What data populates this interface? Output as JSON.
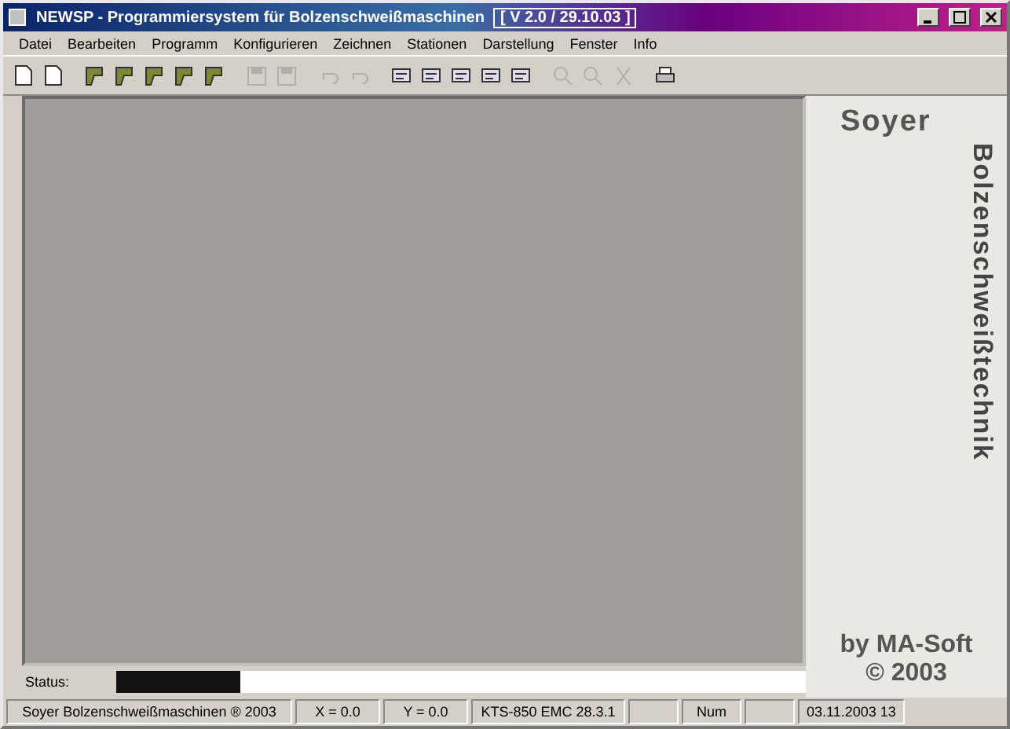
{
  "window": {
    "title": "NEWSP - Programmiersystem für Bolzenschweißmaschinen",
    "version": "[ V 2.0 / 29.10.03 ]"
  },
  "menu": [
    "Datei",
    "Bearbeiten",
    "Programm",
    "Konfigurieren",
    "Zeichnen",
    "Stationen",
    "Darstellung",
    "Fenster",
    "Info"
  ],
  "toolbar": [
    {
      "kind": "doc",
      "disabled": false
    },
    {
      "kind": "doc",
      "disabled": false
    },
    {
      "kind": "sep"
    },
    {
      "kind": "gun",
      "disabled": false
    },
    {
      "kind": "gun",
      "disabled": false
    },
    {
      "kind": "gun",
      "disabled": false
    },
    {
      "kind": "gun",
      "disabled": false
    },
    {
      "kind": "gun",
      "disabled": false
    },
    {
      "kind": "sep"
    },
    {
      "kind": "save",
      "disabled": true
    },
    {
      "kind": "save",
      "disabled": true
    },
    {
      "kind": "sep"
    },
    {
      "kind": "undo",
      "disabled": true
    },
    {
      "kind": "undo",
      "disabled": true
    },
    {
      "kind": "sep"
    },
    {
      "kind": "tool",
      "disabled": false
    },
    {
      "kind": "tool",
      "disabled": false
    },
    {
      "kind": "tool",
      "disabled": false
    },
    {
      "kind": "tool",
      "disabled": false
    },
    {
      "kind": "tool",
      "disabled": false
    },
    {
      "kind": "sep"
    },
    {
      "kind": "zoom",
      "disabled": true
    },
    {
      "kind": "zoom",
      "disabled": true
    },
    {
      "kind": "cut",
      "disabled": true
    },
    {
      "kind": "sep"
    },
    {
      "kind": "print",
      "disabled": false
    }
  ],
  "brand": {
    "name": "Soyer",
    "vertical": "Bolzenschweißtechnik",
    "author": "by MA-Soft",
    "copyright": "© 2003"
  },
  "progress": {
    "label": "Status:",
    "level": 0.18
  },
  "status_bar": [
    {
      "kind": "text",
      "text": "Soyer Bolzenschweißmaschinen ® 2003"
    },
    {
      "kind": "text",
      "text": "X = 0.0"
    },
    {
      "kind": "text",
      "text": "Y = 0.0"
    },
    {
      "kind": "text",
      "text": "KTS-850 EMC 28.3.1"
    },
    {
      "kind": "blank"
    },
    {
      "kind": "text",
      "text": "Num"
    },
    {
      "kind": "blank"
    },
    {
      "kind": "text",
      "text": "03.11.2003 13"
    }
  ]
}
